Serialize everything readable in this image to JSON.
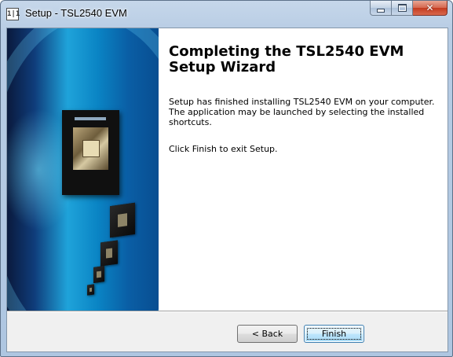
{
  "window": {
    "title": "Setup - TSL2540 EVM",
    "icon_name": "setup-app-icon",
    "icon_glyph": "1|1",
    "controls": {
      "minimize_icon": "minimize-icon",
      "maximize_icon": "maximize-icon",
      "close_icon": "close-icon",
      "close_glyph": "✕"
    }
  },
  "wizard": {
    "heading": "Completing the TSL2540 EVM Setup Wizard",
    "paragraph1": "Setup has finished installing TSL2540 EVM on your computer. The application may be launched by selecting the installed shortcuts.",
    "paragraph2": "Click Finish to exit Setup."
  },
  "buttons": {
    "back_label": "< Back",
    "finish_label": "Finish"
  },
  "colors": {
    "title_bar": "#b7cce4",
    "banner_accent": "#1fa3da",
    "close_button": "#c33a1f",
    "finish_button_border": "#3c7fb1"
  }
}
